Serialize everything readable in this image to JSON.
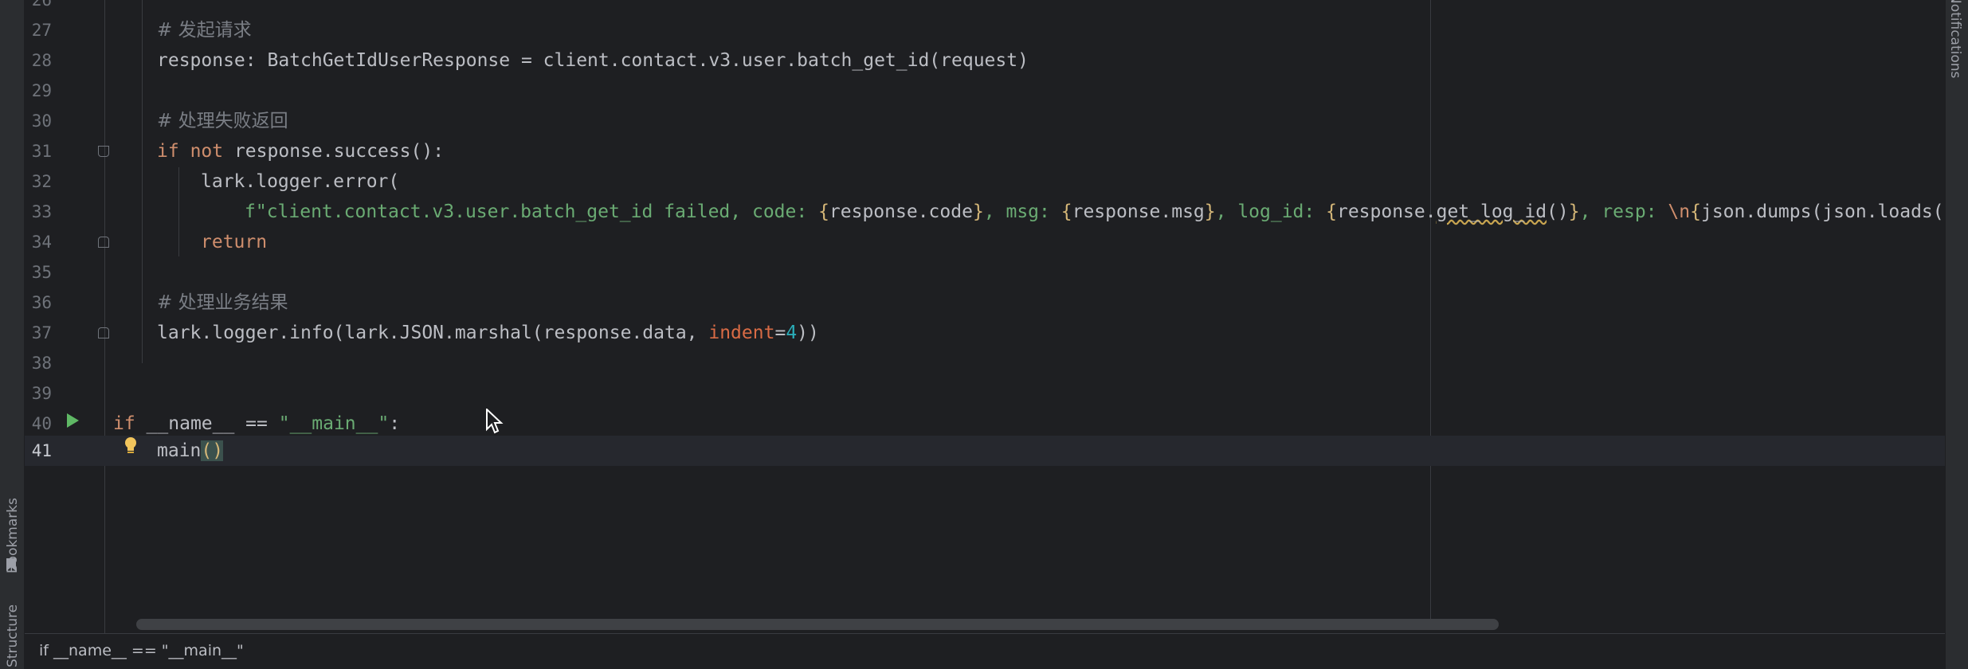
{
  "tool_windows": {
    "notifications_label": "Notifications",
    "bookmarks_label": "Bookmarks",
    "structure_label": "Structure"
  },
  "editor": {
    "lines": [
      {
        "no": "26",
        "text": ""
      },
      {
        "no": "27",
        "comment": "# 发起请求"
      },
      {
        "no": "28",
        "text": "response: BatchGetIdUserResponse = client.contact.v3.user.batch_get_id(request)"
      },
      {
        "no": "29",
        "text": ""
      },
      {
        "no": "30",
        "comment": "# 处理失败返回"
      },
      {
        "no": "31",
        "kw_if": "if",
        "kw_not": "not",
        "rest": " response.success():"
      },
      {
        "no": "32",
        "text": "lark.logger.error("
      },
      {
        "no": "33",
        "seg_prefix": "f\"client.contact.v3.user.batch_get_id failed, code: ",
        "seg_code": "response.code",
        "seg_msg_label": ", msg: ",
        "seg_msg": "response.msg",
        "seg_log_label": ", log_id: ",
        "seg_log_a": "response.",
        "seg_log_b": "get_log_id",
        "seg_log_c": "()",
        "seg_resp_label": ", resp: ",
        "seg_newline": "\\n",
        "seg_tail": "json.dumps(json.loads(r"
      },
      {
        "no": "34",
        "kw": "return"
      },
      {
        "no": "35",
        "text": ""
      },
      {
        "no": "36",
        "comment": "# 处理业务结果"
      },
      {
        "no": "37",
        "pre": "lark.logger.info(lark.JSON.marshal(response.data, ",
        "param": "indent",
        "eq": "=",
        "num": "4",
        "post": "))"
      },
      {
        "no": "38",
        "text": ""
      },
      {
        "no": "39",
        "text": ""
      },
      {
        "no": "40",
        "kw_if": "if",
        "mid": " __name__ == ",
        "str": "\"__main__\"",
        "colon": ":"
      },
      {
        "no": "41",
        "call": "main",
        "paren_open": "(",
        "paren_close": ")"
      }
    ]
  },
  "breadcrumb": {
    "text": "if __name__ == \"__main__\""
  },
  "icons": {
    "run": "run-gutter-icon",
    "bulb": "intention-bulb-icon",
    "bookmark": "bookmark-icon",
    "cursor": "mouse-pointer-icon"
  },
  "colors": {
    "background": "#1e1f22",
    "keyword": "#cf8e6d",
    "string": "#6aab73",
    "comment": "#7a7e85",
    "number": "#2aacb8",
    "run": "#5fb865"
  }
}
